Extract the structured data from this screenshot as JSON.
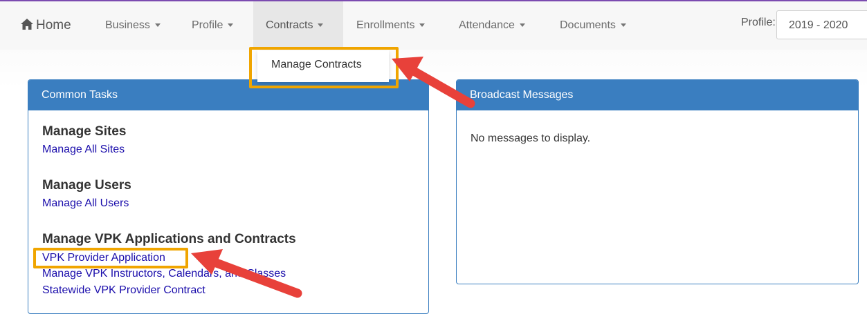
{
  "nav": {
    "home_label": "Home",
    "items": [
      {
        "label": "Business"
      },
      {
        "label": "Profile"
      },
      {
        "label": "Contracts"
      },
      {
        "label": "Enrollments"
      },
      {
        "label": "Attendance"
      },
      {
        "label": "Documents"
      }
    ],
    "active_item": "Contracts",
    "profile_label": "Profile:",
    "profile_value": "2019 - 2020"
  },
  "contracts_menu": {
    "items": [
      {
        "label": "Manage Contracts"
      }
    ]
  },
  "common_tasks": {
    "title": "Common Tasks",
    "sections": [
      {
        "title": "Manage Sites",
        "links": [
          "Manage All Sites"
        ]
      },
      {
        "title": "Manage Users",
        "links": [
          "Manage All Users"
        ]
      },
      {
        "title": "Manage VPK Applications and Contracts",
        "links": [
          "VPK Provider Application",
          "Manage VPK Instructors, Calendars, and Classes",
          "Statewide VPK Provider Contract"
        ]
      }
    ]
  },
  "broadcast": {
    "title": "Broadcast Messages",
    "empty_text": "No messages to display."
  },
  "colors": {
    "panel_header": "#3a7ec0",
    "highlight_box": "#f0a500",
    "arrow": "#e8413a",
    "link": "#1a0dab"
  }
}
